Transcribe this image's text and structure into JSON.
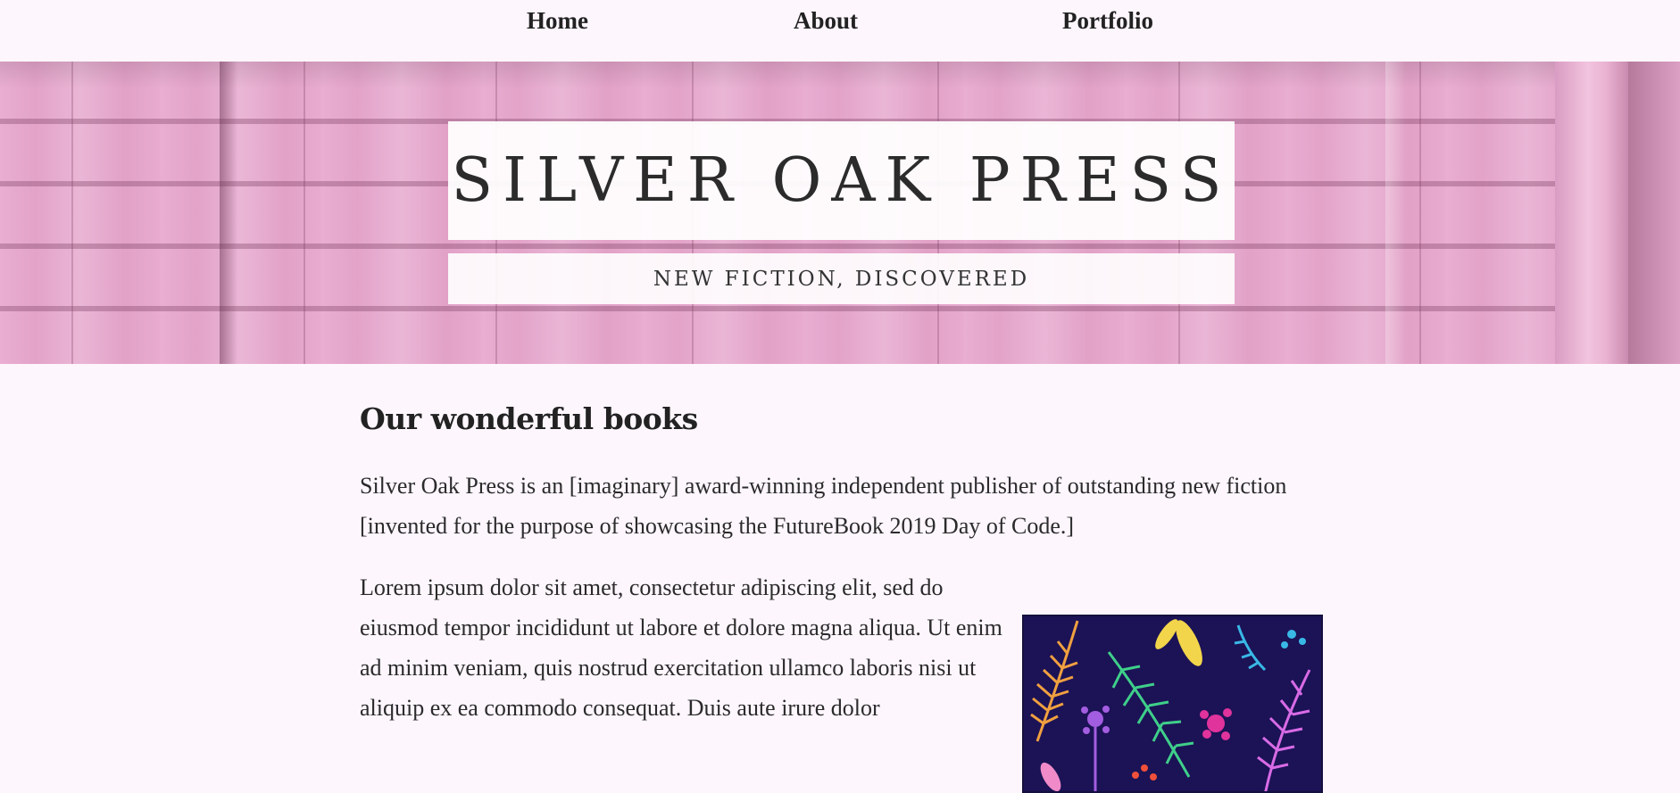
{
  "nav": {
    "items": [
      {
        "label": "Home"
      },
      {
        "label": "About"
      },
      {
        "label": "Portfolio"
      }
    ]
  },
  "hero": {
    "title": "SILVER OAK PRESS",
    "tagline": "NEW FICTION, DISCOVERED"
  },
  "main": {
    "heading": "Our wonderful books",
    "intro": "Silver Oak Press is an [imaginary] award-winning independent publisher of outstanding new fiction [invented for the purpose of showcasing the FutureBook 2019 Day of Code.]",
    "lorem": "Lorem ipsum dolor sit amet, consectetur adipiscing elit, sed do eiusmod tempor incididunt ut labore et dolore magna aliqua. Ut enim ad minim veniam, quis nostrud exercitation ullamco laboris nisi ut aliquip ex ea commodo consequat. Duis aute irure dolor"
  },
  "colors": {
    "page_bg": "#fdf6fd",
    "brick": "#e6a9cf",
    "cover_bg": "#1c1256"
  }
}
